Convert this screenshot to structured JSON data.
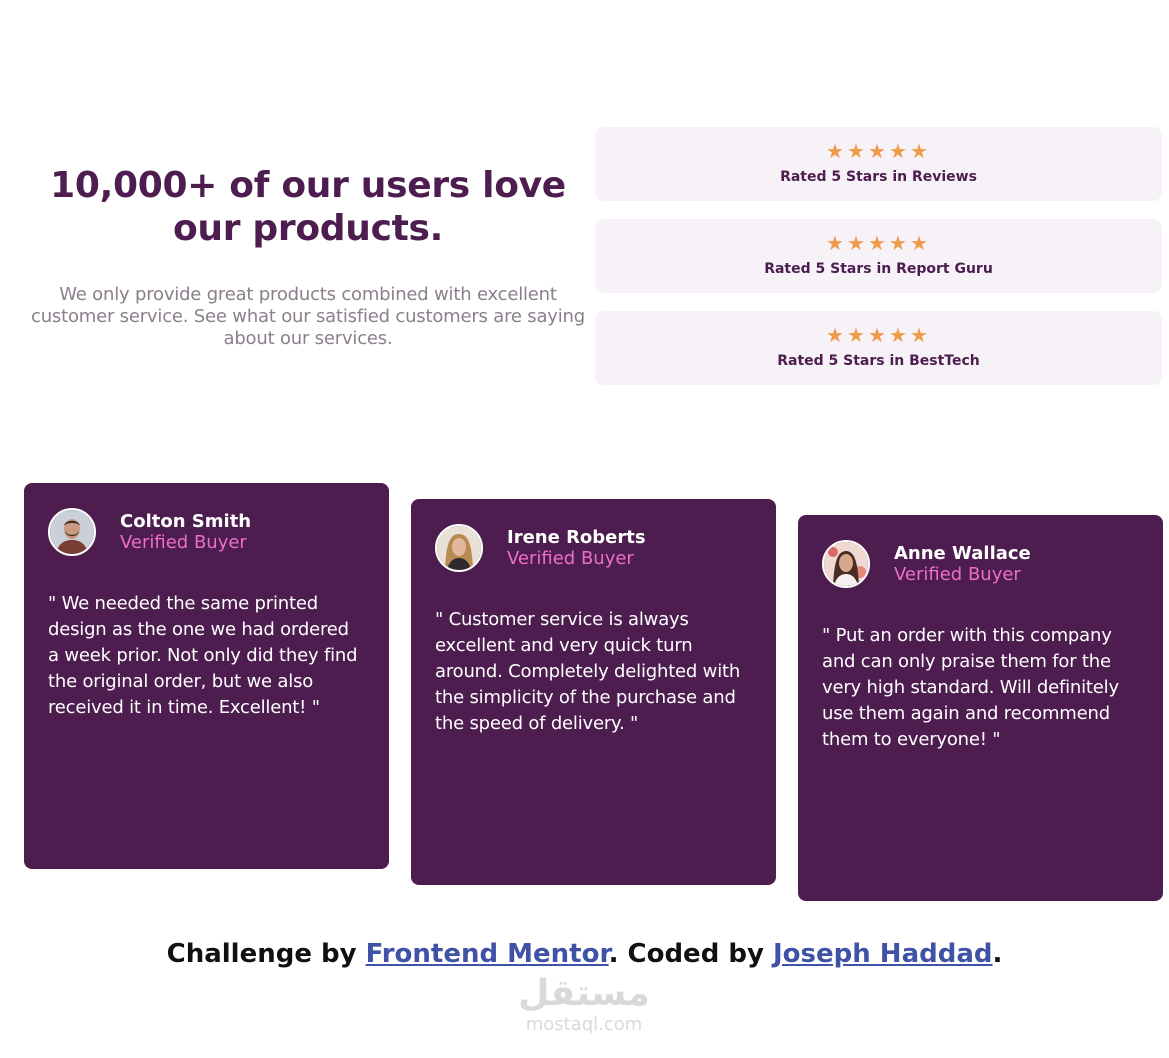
{
  "intro": {
    "headline": "10,000+ of our users love our products.",
    "body": "We only provide great products combined with excellent customer service. See what our satisfied customers are saying about our services."
  },
  "colors": {
    "brand_purple": "#4d1d4f",
    "accent_pink": "#ed6ec8",
    "star_orange": "#ee9b4a",
    "rating_bg": "#f7f2f8",
    "muted_text": "#8a7f8b",
    "link_blue": "#3f52a6"
  },
  "ratings": [
    {
      "stars": 5,
      "star_icon": "star-icon",
      "label": "Rated 5 Stars in Reviews"
    },
    {
      "stars": 5,
      "star_icon": "star-icon",
      "label": "Rated 5 Stars in Report Guru"
    },
    {
      "stars": 5,
      "star_icon": "star-icon",
      "label": "Rated 5 Stars in BestTech"
    }
  ],
  "testimonials": [
    {
      "name": "Colton Smith",
      "role": "Verified Buyer",
      "quote": "\" We needed the same printed design as the one we had ordered a week prior. Not only did they find the original order, but we also received it in time. Excellent! \"",
      "avatar_icon": "avatar-photo-icon"
    },
    {
      "name": "Irene Roberts",
      "role": "Verified Buyer",
      "quote": "\" Customer service is always excellent and very quick turn around. Completely delighted with the simplicity of the purchase and the speed of delivery. \"",
      "avatar_icon": "avatar-photo-icon"
    },
    {
      "name": "Anne Wallace",
      "role": "Verified Buyer",
      "quote": "\" Put an order with this company and can only praise them for the very high standard. Will definitely use them again and recommend them to everyone! \"",
      "avatar_icon": "avatar-photo-icon"
    }
  ],
  "footer": {
    "challenge_prefix": "Challenge by ",
    "challenge_link": "Frontend Mentor",
    "coded_prefix": ". Coded by ",
    "author_link": "Joseph Haddad",
    "suffix": "."
  },
  "watermark": {
    "arabic": "مستقل",
    "latin": "mostaql.com"
  }
}
